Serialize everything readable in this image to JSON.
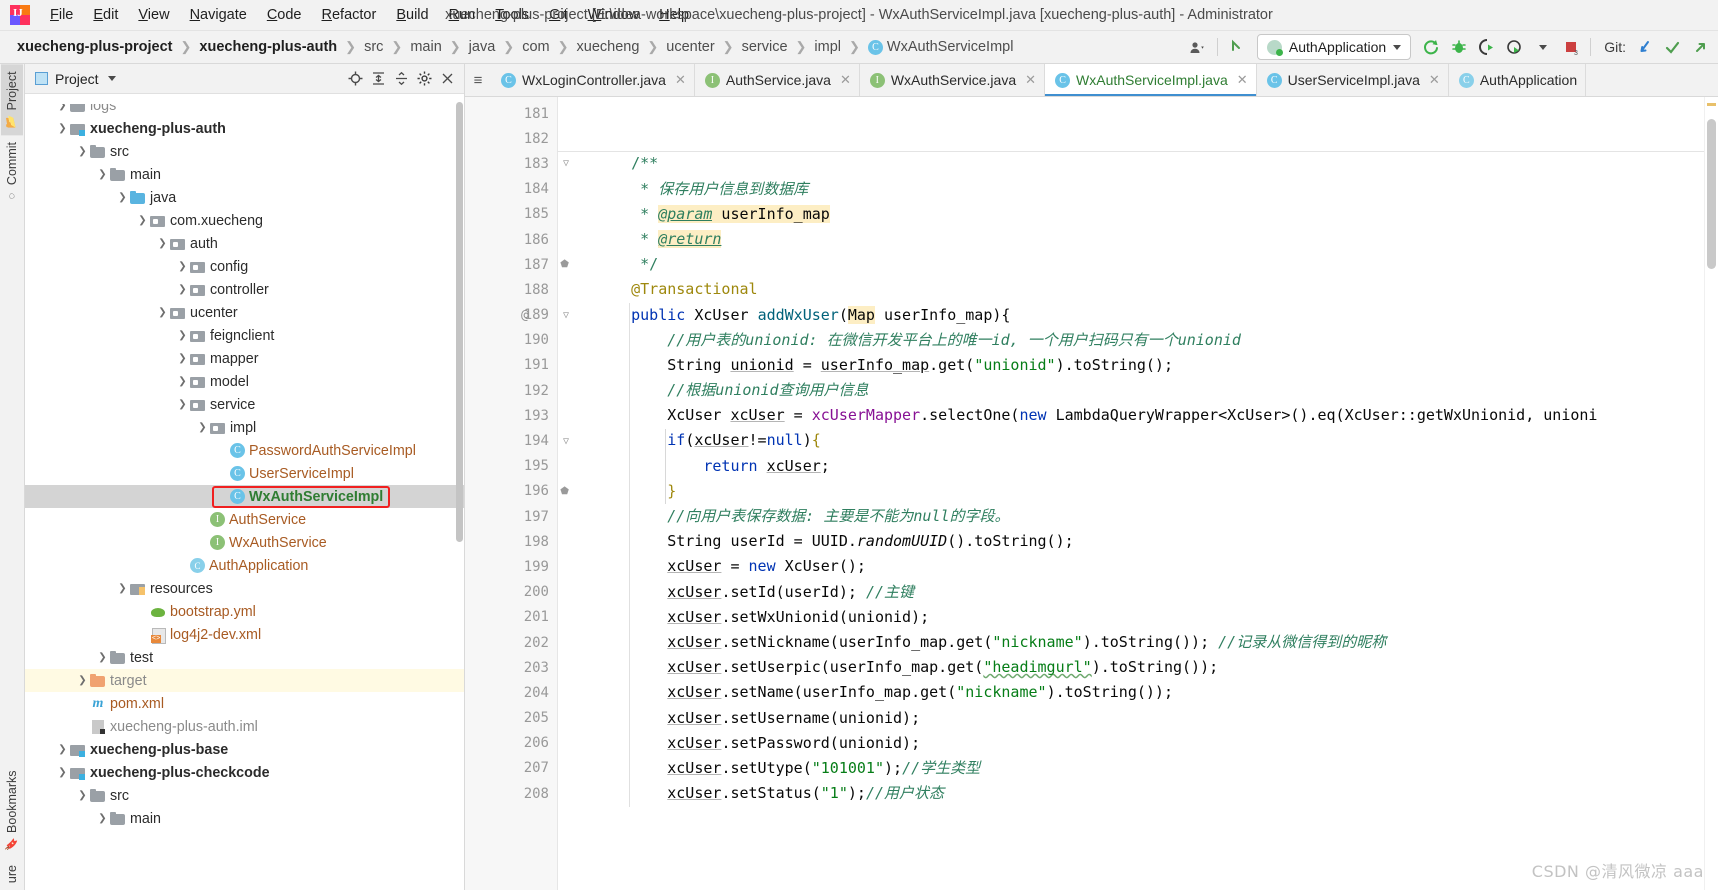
{
  "window": {
    "title": "xuecheng-plus-project [E:\\idea-workspace\\xuecheng-plus-project] - WxAuthServiceImpl.java [xuecheng-plus-auth] - Administrator",
    "logo_letter": "IJ"
  },
  "menubar": [
    {
      "label": "File",
      "mnemonic": "F"
    },
    {
      "label": "Edit",
      "mnemonic": "E"
    },
    {
      "label": "View",
      "mnemonic": "V"
    },
    {
      "label": "Navigate",
      "mnemonic": "N"
    },
    {
      "label": "Code",
      "mnemonic": "C"
    },
    {
      "label": "Refactor",
      "mnemonic": "R"
    },
    {
      "label": "Build",
      "mnemonic": "B"
    },
    {
      "label": "Run",
      "mnemonic": "R"
    },
    {
      "label": "Tools",
      "mnemonic": "T"
    },
    {
      "label": "Git",
      "mnemonic": "G"
    },
    {
      "label": "Window",
      "mnemonic": "W"
    },
    {
      "label": "Help",
      "mnemonic": "H"
    }
  ],
  "breadcrumb": [
    {
      "label": "xuecheng-plus-project",
      "bold": true,
      "icon": null
    },
    {
      "label": "xuecheng-plus-auth",
      "bold": true,
      "icon": null
    },
    {
      "label": "src",
      "bold": false,
      "icon": null
    },
    {
      "label": "main",
      "bold": false,
      "icon": null
    },
    {
      "label": "java",
      "bold": false,
      "icon": null
    },
    {
      "label": "com",
      "bold": false,
      "icon": null
    },
    {
      "label": "xuecheng",
      "bold": false,
      "icon": null
    },
    {
      "label": "ucenter",
      "bold": false,
      "icon": null
    },
    {
      "label": "service",
      "bold": false,
      "icon": null
    },
    {
      "label": "impl",
      "bold": false,
      "icon": null
    },
    {
      "label": "WxAuthServiceImpl",
      "bold": false,
      "icon": "class-badge"
    }
  ],
  "toolbar": {
    "run_config": "AuthApplication",
    "git_label": "Git:",
    "icons": [
      "user-settings-icon",
      "updates-icon",
      "run-icon",
      "debug-icon",
      "run-with-coverage-icon",
      "profile-icon",
      "stop-icon",
      "git-update-icon",
      "git-commit-icon",
      "git-push-icon"
    ],
    "stop_badge": "3"
  },
  "toolstrip": {
    "top": [
      {
        "label": "Project",
        "icon": "project-icon",
        "active": true
      },
      {
        "label": "Commit",
        "icon": "commit-icon",
        "active": false
      }
    ],
    "bottom": [
      {
        "label": "Bookmarks",
        "icon": "bookmark-icon",
        "active": false
      },
      {
        "label": "ure",
        "icon": "structure-icon",
        "active": false
      }
    ]
  },
  "project_panel": {
    "title": "Project",
    "actions": [
      "locate-icon",
      "expand-all-icon",
      "collapse-all-icon",
      "settings-icon",
      "hide-icon"
    ],
    "tree": [
      {
        "indent": 1,
        "arrow": "right",
        "icon": "folder",
        "label": "logs",
        "style": "dim",
        "partial": true
      },
      {
        "indent": 1,
        "arrow": "down",
        "icon": "module",
        "label": "xuecheng-plus-auth",
        "style": "bold"
      },
      {
        "indent": 2,
        "arrow": "down",
        "icon": "folder",
        "label": "src",
        "style": "plain"
      },
      {
        "indent": 3,
        "arrow": "down",
        "icon": "folder",
        "label": "main",
        "style": "plain"
      },
      {
        "indent": 4,
        "arrow": "down",
        "icon": "folder-blue",
        "label": "java",
        "style": "plain"
      },
      {
        "indent": 5,
        "arrow": "down",
        "icon": "package",
        "label": "com.xuecheng",
        "style": "plain"
      },
      {
        "indent": 6,
        "arrow": "down",
        "icon": "package",
        "label": "auth",
        "style": "plain"
      },
      {
        "indent": 7,
        "arrow": "right",
        "icon": "package",
        "label": "config",
        "style": "plain"
      },
      {
        "indent": 7,
        "arrow": "right",
        "icon": "package",
        "label": "controller",
        "style": "plain"
      },
      {
        "indent": 6,
        "arrow": "down",
        "icon": "package",
        "label": "ucenter",
        "style": "plain"
      },
      {
        "indent": 7,
        "arrow": "right",
        "icon": "package",
        "label": "feignclient",
        "style": "plain"
      },
      {
        "indent": 7,
        "arrow": "right",
        "icon": "package",
        "label": "mapper",
        "style": "plain"
      },
      {
        "indent": 7,
        "arrow": "right",
        "icon": "package",
        "label": "model",
        "style": "plain"
      },
      {
        "indent": 7,
        "arrow": "down",
        "icon": "package",
        "label": "service",
        "style": "plain"
      },
      {
        "indent": 8,
        "arrow": "down",
        "icon": "package",
        "label": "impl",
        "style": "plain"
      },
      {
        "indent": 9,
        "arrow": "none",
        "icon": "class",
        "label": "PasswordAuthServiceImpl",
        "style": "orange"
      },
      {
        "indent": 9,
        "arrow": "none",
        "icon": "class",
        "label": "UserServiceImpl",
        "style": "orange"
      },
      {
        "indent": 9,
        "arrow": "none",
        "icon": "class",
        "label": "WxAuthServiceImpl",
        "style": "green",
        "selected": true,
        "annotated": true
      },
      {
        "indent": 8,
        "arrow": "none",
        "icon": "interface",
        "label": "AuthService",
        "style": "orange"
      },
      {
        "indent": 8,
        "arrow": "none",
        "icon": "interface",
        "label": "WxAuthService",
        "style": "orange"
      },
      {
        "indent": 7,
        "arrow": "none",
        "icon": "spring-class",
        "label": "AuthApplication",
        "style": "orange"
      },
      {
        "indent": 4,
        "arrow": "down",
        "icon": "resources",
        "label": "resources",
        "style": "plain"
      },
      {
        "indent": 5,
        "arrow": "none",
        "icon": "yml",
        "label": "bootstrap.yml",
        "style": "orange"
      },
      {
        "indent": 5,
        "arrow": "none",
        "icon": "xml",
        "label": "log4j2-dev.xml",
        "style": "orange"
      },
      {
        "indent": 3,
        "arrow": "right",
        "icon": "folder",
        "label": "test",
        "style": "plain"
      },
      {
        "indent": 2,
        "arrow": "right",
        "icon": "folder-orange",
        "label": "target",
        "style": "dim",
        "excluded": true
      },
      {
        "indent": 2,
        "arrow": "none",
        "icon": "maven",
        "label": "pom.xml",
        "style": "orange"
      },
      {
        "indent": 2,
        "arrow": "none",
        "icon": "iml",
        "label": "xuecheng-plus-auth.iml",
        "style": "dim"
      },
      {
        "indent": 1,
        "arrow": "right",
        "icon": "module",
        "label": "xuecheng-plus-base",
        "style": "bold"
      },
      {
        "indent": 1,
        "arrow": "down",
        "icon": "module",
        "label": "xuecheng-plus-checkcode",
        "style": "bold"
      },
      {
        "indent": 2,
        "arrow": "down",
        "icon": "folder",
        "label": "src",
        "style": "plain"
      },
      {
        "indent": 3,
        "arrow": "down",
        "icon": "folder",
        "label": "main",
        "style": "plain"
      }
    ]
  },
  "editor_tabs": [
    {
      "label": "WxLoginController.java",
      "icon": "class",
      "active": false
    },
    {
      "label": "AuthService.java",
      "icon": "interface",
      "active": false
    },
    {
      "label": "WxAuthService.java",
      "icon": "interface",
      "active": false
    },
    {
      "label": "WxAuthServiceImpl.java",
      "icon": "class",
      "active": true
    },
    {
      "label": "UserServiceImpl.java",
      "icon": "class",
      "active": false
    },
    {
      "label": "AuthApplication",
      "icon": "spring-class",
      "active": false
    }
  ],
  "code": {
    "first_line_number": 181,
    "line_numbers": [
      181,
      182,
      183,
      184,
      185,
      186,
      187,
      188,
      189,
      190,
      191,
      192,
      193,
      194,
      195,
      196,
      197,
      198,
      199,
      200,
      201,
      202,
      203,
      204,
      205,
      206,
      207,
      208
    ],
    "gutter_marks": {
      "189": "@"
    },
    "lines": [
      "",
      "",
      "    /**",
      "     * 保存用户信息到数据库",
      "     * @param userInfo_map",
      "     * @return",
      "     */",
      "    @Transactional",
      "    public XcUser addWxUser(Map userInfo_map){",
      "        //用户表的unionid: 在微信开发平台上的唯一id, 一个用户扫码只有一个unionid",
      "        String unionid = userInfo_map.get(\"unionid\").toString();",
      "        //根据unionid查询用户信息",
      "        XcUser xcUser = xcUserMapper.selectOne(new LambdaQueryWrapper<XcUser>().eq(XcUser::getWxUnionid, unioni",
      "        if(xcUser!=null){",
      "            return xcUser;",
      "        }",
      "        //向用户表保存数据: 主要是不能为null的字段。",
      "        String userId = UUID.randomUUID().toString();",
      "        xcUser = new XcUser();",
      "        xcUser.setId(userId); //主键",
      "        xcUser.setWxUnionid(unionid);",
      "        xcUser.setNickname(userInfo_map.get(\"nickname\").toString()); //记录从微信得到的昵称",
      "        xcUser.setUserpic(userInfo_map.get(\"headimgurl\").toString());",
      "        xcUser.setName(userInfo_map.get(\"nickname\").toString());",
      "        xcUser.setUsername(unionid);",
      "        xcUser.setPassword(unionid);",
      "        xcUser.setUtype(\"101001\");//学生类型",
      "        xcUser.setStatus(\"1\");//用户状态"
    ]
  },
  "watermark": "CSDN @清风微凉 aaa",
  "colors": {
    "accent": "#3f8fd0",
    "annotation_red": "#f02020",
    "tab_active_text": "#2f7d32",
    "keyword": "#0033b3",
    "string": "#067d17",
    "comment": "#2f7f5f",
    "field": "#871094",
    "annotation": "#9e880d",
    "highlight": "#fdeec4",
    "excluded_bg": "#fffae3",
    "selected_bg": "#d4d4d4"
  }
}
